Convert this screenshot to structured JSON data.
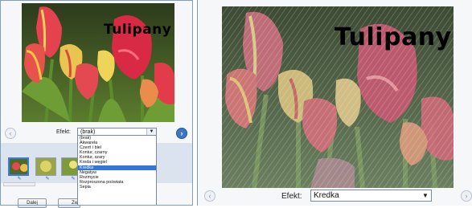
{
  "left_panel": {
    "photo_caption": "Tulipany",
    "effect_label": "Efekt:",
    "effect_value": "(brak)",
    "dropdown_options": [
      "(brak)",
      "Akwarela",
      "Czerń i biel",
      "Kontur, czarny",
      "Kontur, szary",
      "Kreda i węgiel",
      "Kredka",
      "Negatyw",
      "Rozmycie",
      "Rozproszona poświata",
      "Sepia"
    ],
    "dropdown_selected_index": 6,
    "buttons": [
      "Dalej",
      "Zw"
    ]
  },
  "right_panel": {
    "photo_caption": "Tulipany",
    "effect_label": "Efekt:",
    "effect_value": "Kredka"
  },
  "icons": {
    "prev": "‹",
    "next": "›",
    "dropdown_arrow": "▼",
    "thumb_icon": "✎"
  },
  "colors": {
    "accent_blue": "#3c78c8",
    "caption_yellow": "#e8f000",
    "selection": "#3377d6"
  }
}
